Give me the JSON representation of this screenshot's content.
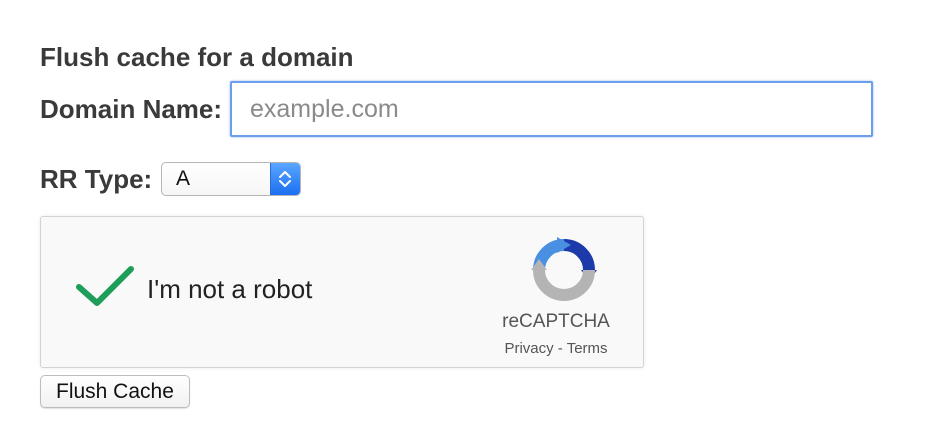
{
  "form": {
    "title": "Flush cache for a domain",
    "domain_label": "Domain Name:",
    "domain_placeholder": "example.com",
    "domain_value": "",
    "rr_label": "RR Type:",
    "rr_selected": "A",
    "submit_label": "Flush Cache"
  },
  "captcha": {
    "label": "I'm not a robot",
    "checked": true,
    "brand": "reCAPTCHA",
    "privacy_link": "Privacy",
    "separator": " - ",
    "terms_link": "Terms",
    "check_icon": "checkmark-icon",
    "logo_icon": "recaptcha-logo-icon",
    "colors": {
      "check": "#1e9e5a",
      "logo_blue": "#4a90e2",
      "logo_dark_blue": "#1c3aa9",
      "logo_gray": "#b4b4b4"
    }
  },
  "colors": {
    "input_focus_border": "#6d9eeb",
    "select_arrow": "#1b6ff1"
  }
}
